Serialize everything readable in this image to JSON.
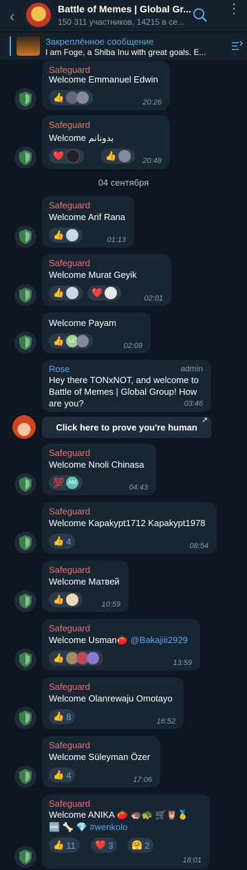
{
  "header": {
    "back_glyph": "‹",
    "title": "Battle of Memes | Global Gr...",
    "subtitle": "150 311 участников, 14215 в се...",
    "menu_glyph": "⋮"
  },
  "pinned": {
    "title": "Закреплённое сообщение",
    "text": "I am Foge, a Shiba Inu with great goals. E..."
  },
  "date_separator": "04 сентября",
  "messages": [
    {
      "sender": "Safeguard",
      "text": "Welcome Emmanuel Edwin",
      "time": "20:26",
      "r1": "👍",
      "r2": "",
      "r3": ""
    },
    {
      "sender": "Safeguard",
      "text": "Welcome بدونانم",
      "time": "20:48",
      "r1": "❤️",
      "r2": "👍",
      "r3": ""
    },
    {
      "sender": "Safeguard",
      "text": "Welcome Arif Rana",
      "time": "01:13",
      "r1": "👍",
      "r2": "",
      "r3": ""
    },
    {
      "sender": "Safeguard",
      "text": "Welcome Murat Geyik",
      "time": "02:01",
      "r1": "👍",
      "r2": "❤️",
      "r3": ""
    },
    {
      "sender": "",
      "text": "Welcome Payam",
      "time": "02:09",
      "r1": "👍",
      "r2": "LC",
      "r3": ""
    },
    {
      "sender": "Safeguard",
      "text": "Welcome Nnoli Chinasa",
      "time": "04:43",
      "r1": "💯",
      "r2": "AM",
      "r3": ""
    },
    {
      "sender": "Safeguard",
      "text": "Welcome Kapakypt1712 Kapakypt1978",
      "time": "08:54",
      "r1": "👍",
      "r2": "4",
      "r3": ""
    },
    {
      "sender": "Safeguard",
      "text": "Welcome Матвей",
      "time": "10:59",
      "r1": "👍",
      "r2": "",
      "r3": ""
    },
    {
      "sender": "Safeguard",
      "text": "Welcome Usman🍅",
      "mention": "@Bakajiii2929",
      "time": "13:59",
      "r1": "👍",
      "r2": "",
      "r3": ""
    },
    {
      "sender": "Safeguard",
      "text": "Welcome Olanrewaju Omotayo",
      "time": "16:52",
      "r1": "👍",
      "r2": "8",
      "r3": ""
    },
    {
      "sender": "Safeguard",
      "text": "Welcome Süleyman Özer",
      "time": "17:06",
      "r1": "👍",
      "r2": "4",
      "r3": ""
    },
    {
      "sender": "Safeguard",
      "text": "Welcome ANIKA 🍅 🦔🐢 🛒🦉🥇",
      "text2": "🆓 🦴 💎",
      "hashtag": "#wenkolo",
      "time": "18:01",
      "r1": "👍",
      "r1n": "11",
      "r2": "❤️",
      "r2n": "3",
      "r3": "🤗",
      "r3n": "2"
    }
  ],
  "rose": {
    "sender": "Rose",
    "badge": "admin",
    "line1": "Hey there TONxNOT, and welcome to",
    "line2": "Battle of Memes | Global Group! How",
    "line3": "are you?",
    "time": "03:46",
    "button": "Click here to prove you're human",
    "button_arrow": "↗"
  }
}
